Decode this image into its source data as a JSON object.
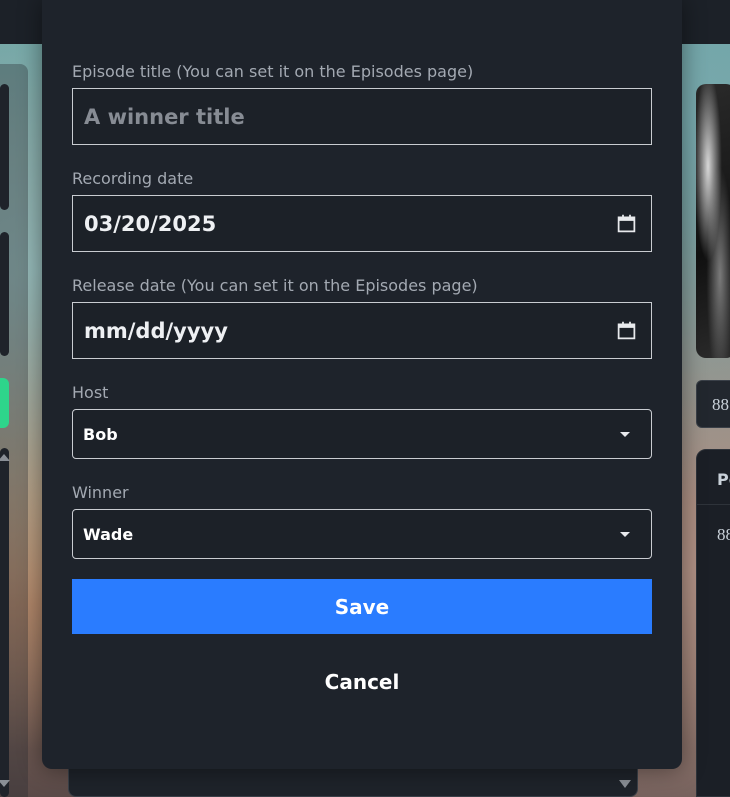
{
  "form": {
    "episode_title": {
      "label": "Episode title (You can set it on the Episodes page)",
      "placeholder": "A winner title",
      "value": ""
    },
    "recording_date": {
      "label": "Recording date",
      "value": "03/20/2025",
      "icon": "calendar-icon"
    },
    "release_date": {
      "label": "Release date (You can set it on the Episodes page)",
      "value": "mm/dd/yyyy",
      "icon": "calendar-icon"
    },
    "host": {
      "label": "Host",
      "selected": "Bob"
    },
    "winner": {
      "label": "Winner",
      "selected": "Wade"
    },
    "save_label": "Save",
    "cancel_label": "Cancel"
  },
  "background": {
    "right_chip_text": "88",
    "right_table_header": "Pc",
    "right_table_cell": "88"
  },
  "colors": {
    "modal_bg": "#1e232b",
    "primary_button": "#2a7cff",
    "label_text": "#a3a9b2",
    "accent_green": "#2ed58b"
  }
}
